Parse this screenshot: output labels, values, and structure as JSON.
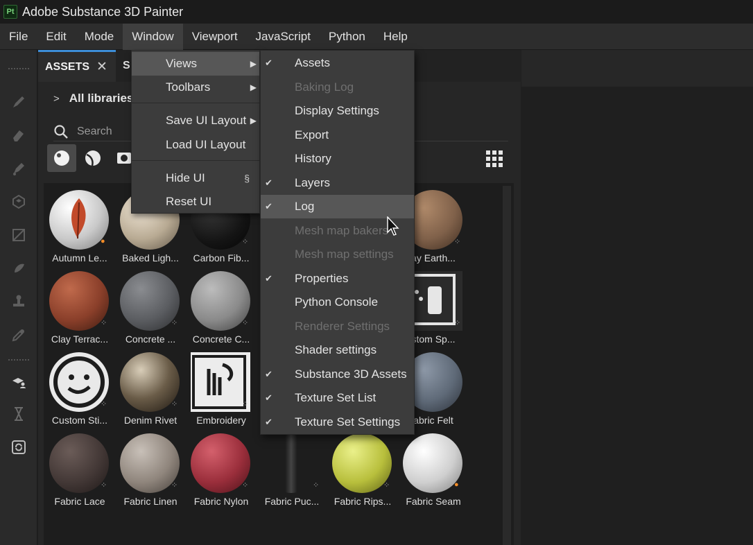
{
  "app": {
    "logo": "Pt",
    "title": "Adobe Substance 3D Painter"
  },
  "menubar": {
    "items": [
      "File",
      "Edit",
      "Mode",
      "Window",
      "Viewport",
      "JavaScript",
      "Python",
      "Help"
    ]
  },
  "panel": {
    "tab_active": "ASSETS",
    "tab_second": "S",
    "breadcrumb": "All libraries",
    "search_placeholder": "Search"
  },
  "assets": [
    {
      "label": "Autumn Le...",
      "badge": "orange"
    },
    {
      "label": "Baked Ligh...",
      "badge": ""
    },
    {
      "label": "Carbon Fib...",
      "badge": "gray"
    },
    {
      "label": "",
      "badge": ""
    },
    {
      "label": "",
      "badge": ""
    },
    {
      "label": "ay Earth...",
      "badge": "gray"
    },
    {
      "label": "Clay Terrac...",
      "badge": "gray"
    },
    {
      "label": "Concrete ...",
      "badge": "gray"
    },
    {
      "label": "Concrete C...",
      "badge": "gray"
    },
    {
      "label": "",
      "badge": ""
    },
    {
      "label": "",
      "badge": ""
    },
    {
      "label": "stom Sp...",
      "badge": "gray"
    },
    {
      "label": "Custom Sti...",
      "badge": "gray"
    },
    {
      "label": "Denim Rivet",
      "badge": "gray"
    },
    {
      "label": "Embroidery",
      "badge": "gray"
    },
    {
      "label": "",
      "badge": ""
    },
    {
      "label": "",
      "badge": ""
    },
    {
      "label": "abric Felt",
      "badge": ""
    },
    {
      "label": "Fabric Lace",
      "badge": "gray"
    },
    {
      "label": "Fabric Linen",
      "badge": "gray"
    },
    {
      "label": "Fabric Nylon",
      "badge": "gray"
    },
    {
      "label": "Fabric Puc...",
      "badge": "gray"
    },
    {
      "label": "Fabric Rips...",
      "badge": "gray"
    },
    {
      "label": "Fabric Seam",
      "badge": "orange"
    }
  ],
  "window_menu": {
    "items": [
      {
        "label": "Views",
        "submenu": true
      },
      {
        "label": "Toolbars",
        "submenu": true
      },
      {
        "label": "Save UI Layout",
        "submenu": true
      },
      {
        "label": "Load UI Layout"
      },
      {
        "label": "Hide UI",
        "shortcut": "§"
      },
      {
        "label": "Reset UI"
      }
    ]
  },
  "views_menu": {
    "items": [
      {
        "label": "Assets",
        "checked": true,
        "enabled": true
      },
      {
        "label": "Baking Log",
        "checked": false,
        "enabled": false
      },
      {
        "label": "Display Settings",
        "checked": false,
        "enabled": true
      },
      {
        "label": "Export",
        "checked": false,
        "enabled": true
      },
      {
        "label": "History",
        "checked": false,
        "enabled": true
      },
      {
        "label": "Layers",
        "checked": true,
        "enabled": true
      },
      {
        "label": "Log",
        "checked": true,
        "enabled": true
      },
      {
        "label": "Mesh map bakers",
        "checked": false,
        "enabled": false
      },
      {
        "label": "Mesh map settings",
        "checked": false,
        "enabled": false
      },
      {
        "label": "Properties",
        "checked": true,
        "enabled": true
      },
      {
        "label": "Python Console",
        "checked": false,
        "enabled": true
      },
      {
        "label": "Renderer Settings",
        "checked": false,
        "enabled": false
      },
      {
        "label": "Shader settings",
        "checked": false,
        "enabled": true
      },
      {
        "label": "Substance 3D Assets",
        "checked": true,
        "enabled": true
      },
      {
        "label": "Texture Set List",
        "checked": true,
        "enabled": true
      },
      {
        "label": "Texture Set Settings",
        "checked": true,
        "enabled": true
      }
    ]
  },
  "colors": {
    "accent": "#3d8ed8",
    "badge_orange": "#f28c28"
  }
}
